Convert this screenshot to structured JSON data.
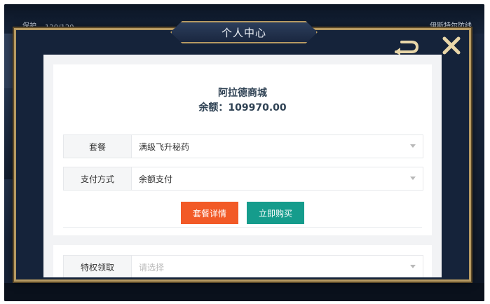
{
  "hud": {
    "left_text": "保护",
    "stats": "120/120",
    "right_text": "伊斯特尔防线"
  },
  "dialog": {
    "title": "个人中心"
  },
  "shop": {
    "name": "阿拉德商城",
    "balance_label": "余额：109970.00"
  },
  "form": {
    "package_label": "套餐",
    "package_value": "满级飞升秘药",
    "payment_label": "支付方式",
    "payment_value": "余额支付",
    "details_button": "套餐详情",
    "buy_button": "立即购买",
    "privilege_label": "特权领取",
    "privilege_placeholder": "请选择"
  },
  "colors": {
    "frame_gold": "#b69a62",
    "orange_button": "#f25a27",
    "teal_button": "#159c8c",
    "text_dark": "#2f4254"
  }
}
